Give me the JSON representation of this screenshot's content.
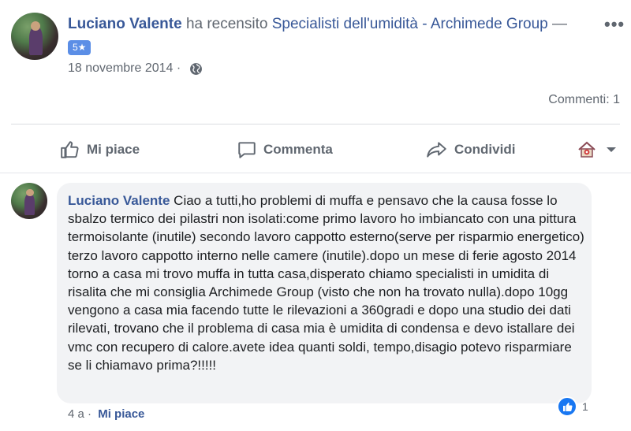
{
  "post": {
    "author": "Luciano Valente",
    "action_text": "ha recensito",
    "page_name": "Specialisti dell'umidità - Archimede Group",
    "page_suffix": "—",
    "rating": "5★",
    "date": "18 novembre 2014",
    "separator": " · ",
    "privacy_icon": "globe-icon",
    "more_icon": "•••",
    "comments_count": "Commenti: 1"
  },
  "actions": {
    "like_label": "Mi piace",
    "comment_label": "Commenta",
    "share_label": "Condividi",
    "audience_icon": "house-icon"
  },
  "comment": {
    "author": "Luciano Valente",
    "text": "Ciao a tutti,ho problemi di muffa e pensavo che la causa fosse lo sbalzo termico dei pilastri non isolati:come primo lavoro ho imbiancato con una pittura termoisolante (inutile) secondo lavoro cappotto esterno(serve per risparmio energetico) terzo lavoro cappotto interno nelle camere (inutile).dopo un mese di ferie agosto 2014 torno a casa mi trovo muffa in tutta casa,disperato chiamo specialisti in umidita di risalita che mi consiglia Archimede Group (visto che non ha trovato nulla).dopo 10gg vengono a casa mia facendo tutte le rilevazioni a 360gradi e dopo una studio dei dati rilevati, trovano che il problema di casa mia è umidita di condensa e devo istallare dei vmc con recupero di calore.avete idea quanti soldi, tempo,disagio potevo risparmiare se li chiamavo prima?!!!!!",
    "age": "4 a",
    "separator": " · ",
    "like_label": "Mi piace",
    "reaction_count": "1",
    "colors": {
      "bubble": "#f2f3f5",
      "link": "#385898",
      "reaction_blue": "#1877f2"
    }
  }
}
